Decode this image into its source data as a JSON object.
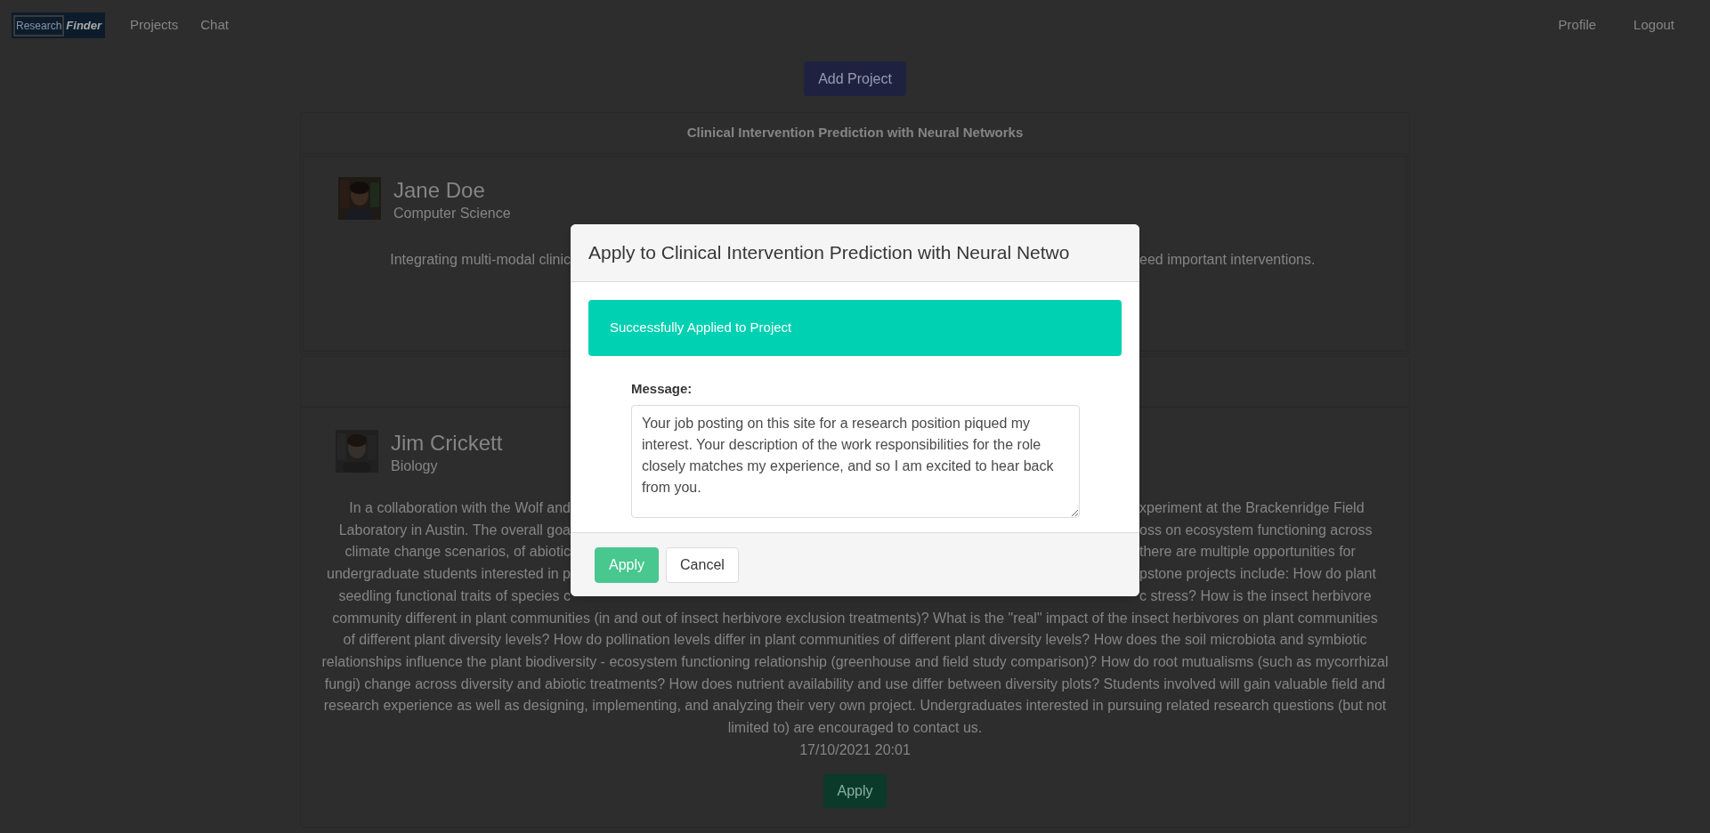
{
  "navbar": {
    "logo": {
      "part_1": "Research",
      "part_2": "Finder"
    },
    "links": [
      {
        "label": "Projects"
      },
      {
        "label": "Chat"
      }
    ],
    "right_links": [
      {
        "label": "Profile"
      },
      {
        "label": "Logout"
      }
    ]
  },
  "add_project_button": "Add Project",
  "projects": [
    {
      "title": "Clinical Intervention Prediction with Neural Networks",
      "author": {
        "name": "Jane Doe",
        "department": "Computer Science"
      },
      "description_lines": [
        {
          "kind": "split",
          "left": "Integrating multi-modal clinic",
          "right": "eed important interventions."
        }
      ]
    },
    {
      "author": {
        "name": "Jim Crickett",
        "department": "Biology"
      },
      "description_lines": [
        {
          "kind": "split",
          "left": "In a collaboration with the Wolf and",
          "right": "xperiment at the Brackenridge Field"
        },
        {
          "kind": "split",
          "left": "Laboratory in Austin. The overall goa",
          "right": "oss on ecosystem functioning across"
        },
        {
          "kind": "split",
          "left": "climate change scenarios, of abiotic",
          "right": "there are multiple opportunities for"
        },
        {
          "kind": "split",
          "left": "undergraduate students interested in p",
          "right": "pstone projects include: How do plant"
        },
        {
          "kind": "split",
          "left": "seedling functional traits of species c",
          "right": "c stress? How is the insect herbivore"
        },
        {
          "kind": "full",
          "text": "community different in plant communities (in and out of insect herbivore exclusion treatments)? What is the \"real\" impact of the insect herbivores on plant communities"
        },
        {
          "kind": "full",
          "text": "of different plant diversity levels? How do pollination levels differ in plant communities of different plant diversity levels? How does the soil microbiota and symbiotic"
        },
        {
          "kind": "full",
          "text": "relationships influence the plant biodiversity - ecosystem functioning relationship (greenhouse and field study comparison)? How do root mutualisms (such as mycorrhizal"
        },
        {
          "kind": "full",
          "text": "fungi) change across diversity and abiotic treatments? How does nutrient availability and use differ between diversity plots? Students involved will gain valuable field and"
        },
        {
          "kind": "full",
          "text": "research experience as well as designing, implementing, and analyzing their very own project. Undergraduates interested in pursuing related research questions (but not"
        },
        {
          "kind": "full",
          "text": "limited to) are encouraged to contact us."
        }
      ],
      "date": "17/10/2021 20:01",
      "apply_button": "Apply"
    }
  ],
  "modal": {
    "title": "Apply to Clinical Intervention Prediction with Neural Netwo",
    "alert": "Successfully Applied to Project",
    "message_label": "Message:",
    "message_value": "Your job posting on this site for a research position piqued my interest. Your description of the work responsibilities for the role closely matches my experience, and so I am excited to hear back from you.",
    "buttons": [
      {
        "label": "Apply",
        "kind": "primary"
      },
      {
        "label": "Cancel",
        "kind": "secondary"
      }
    ]
  }
}
